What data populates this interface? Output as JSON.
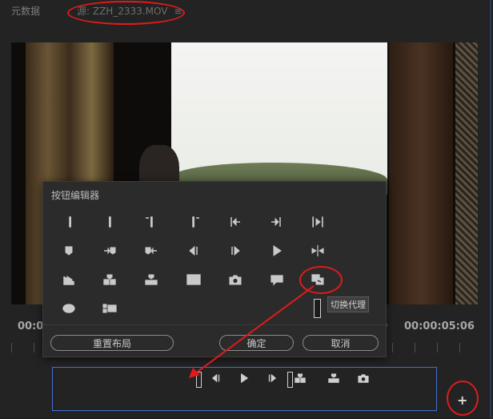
{
  "tabs": {
    "metadata": "元数据",
    "source": "源: ZZH_2333.MOV",
    "source_menu_icon": "hamburger-icon"
  },
  "monitor": {
    "timecode_left": "00:0",
    "timecode_right": "00:00:05:06"
  },
  "dialog": {
    "title": "按钮编辑器",
    "reset_label": "重置布局",
    "ok_label": "确定",
    "cancel_label": "取消",
    "buttons": [
      [
        "mark-in",
        "mark-out",
        "clear-in",
        "clear-out",
        "go-to-in",
        "go-to-out",
        "play-in-to-out"
      ],
      [
        "add-marker",
        "go-to-next-marker",
        "go-to-previous-marker",
        "step-back",
        "step-forward",
        "play",
        "shuttle"
      ],
      [
        "export-frame",
        "insert",
        "overwrite",
        "safe-margins",
        "export-frame-camera",
        "comment",
        "toggle-proxies"
      ],
      [
        "loop",
        "multi-camera"
      ]
    ]
  },
  "tooltip": "切换代理",
  "toolbar": {
    "buttons": [
      "step-back",
      "play",
      "step-forward",
      "insert",
      "overwrite",
      "export-frame-camera"
    ]
  },
  "plus_label": "+",
  "colors": {
    "annotation": "#e01b1b",
    "selection_border": "#3f6fd1"
  }
}
